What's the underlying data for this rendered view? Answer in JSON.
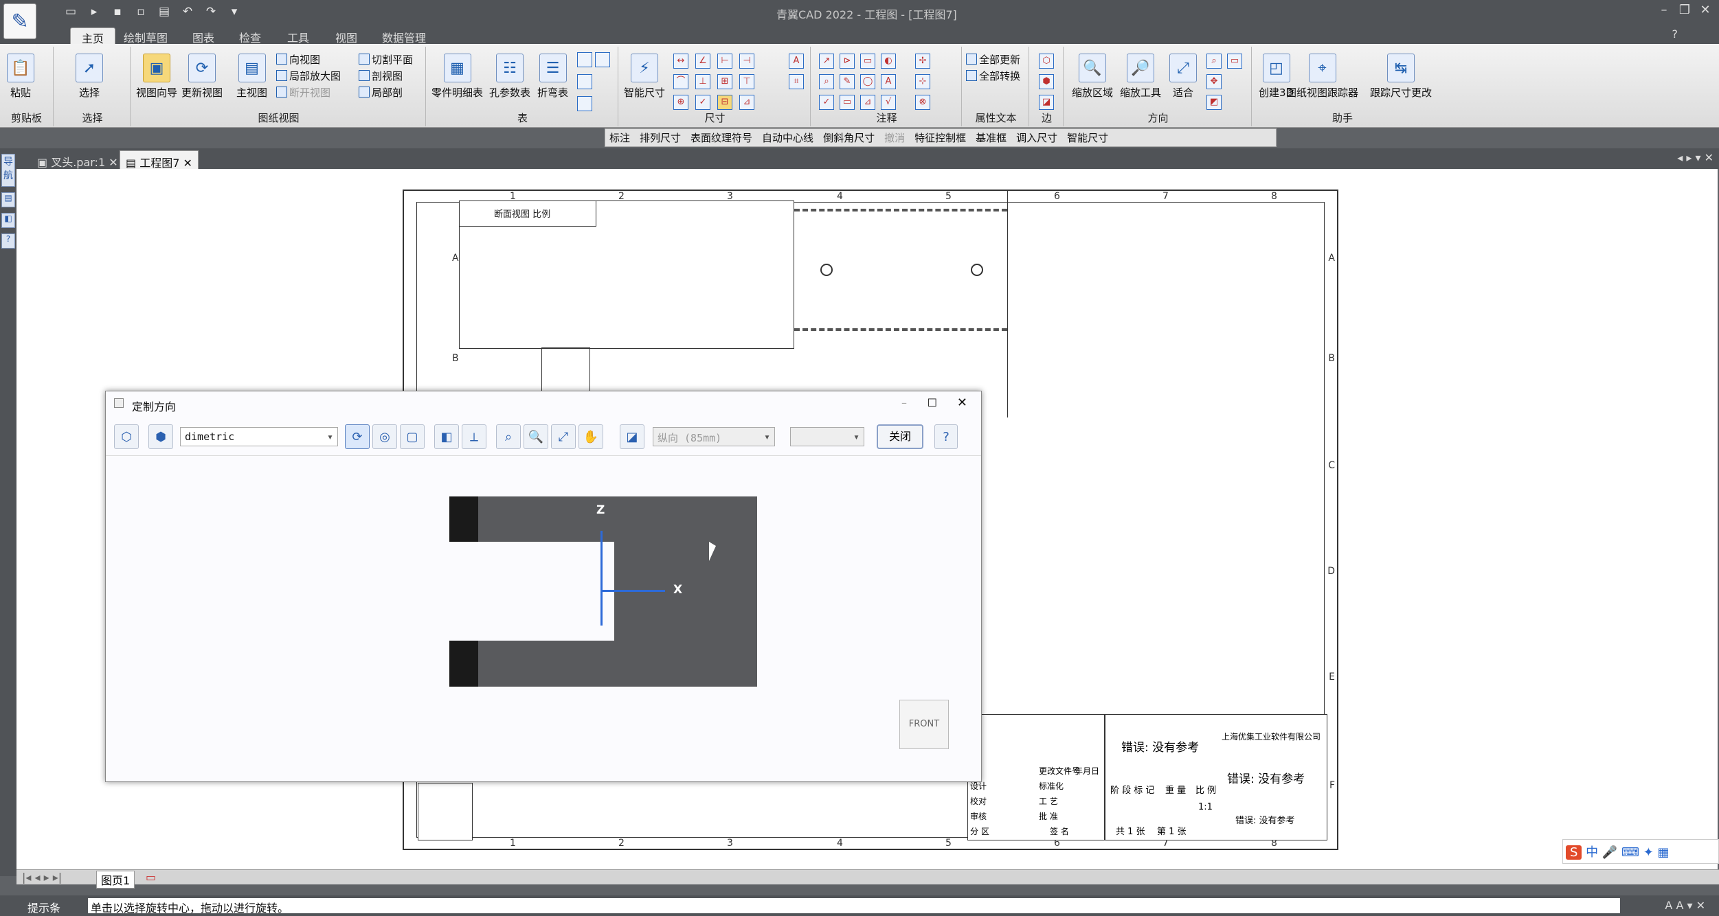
{
  "app": {
    "title": "青翼CAD 2022 - 工程图 - [工程图7]"
  },
  "ribbon_tabs": [
    "主页",
    "绘制草图",
    "图表",
    "检查",
    "工具",
    "视图",
    "数据管理"
  ],
  "groups": {
    "clipboard": {
      "label": "剪贴板",
      "paste": "粘贴"
    },
    "select": {
      "label": "选择",
      "select": "选择"
    },
    "drawing_views": {
      "label": "图纸视图",
      "view_wizard": "视图向导",
      "update_view": "更新视图",
      "main_view": "主视图",
      "direction_view": "向视图",
      "detail_view": "局部放大图",
      "break_view": "断开视图",
      "cut_plane": "切割平面",
      "section_view": "剖视图",
      "partial_section": "局部剖"
    },
    "table": {
      "label": "表",
      "parts_list": "零件明细表",
      "hole_table": "孔参数表",
      "bend_table": "折弯表"
    },
    "dimension": {
      "label": "尺寸",
      "smart_dimension": "智能尺寸"
    },
    "annotation": {
      "label": "注释"
    },
    "property_text": {
      "label": "属性文本",
      "update_all": "全部更新",
      "convert_all": "全部转换"
    },
    "edge": {
      "label": "边"
    },
    "orientation": {
      "label": "方向",
      "zoom_area": "缩放区域",
      "zoom_tool": "缩放工具",
      "fit": "适合"
    },
    "assistant": {
      "label": "助手",
      "create_3d": "创建3D",
      "view_tracker": "图纸视图跟踪器",
      "track_dim": "跟踪尺寸更改"
    }
  },
  "command_bar": [
    "标注",
    "排列尺寸",
    "表面纹理符号",
    "自动中心线",
    "倒斜角尺寸",
    "撤消",
    "特征控制框",
    "基准框",
    "调入尺寸",
    "智能尺寸"
  ],
  "doc_tabs": [
    "叉头.par:1",
    "工程图7"
  ],
  "left_panel_label": "导航",
  "sheet": {
    "cols": [
      "1",
      "2",
      "3",
      "4",
      "5",
      "6",
      "7",
      "8"
    ],
    "rows": [
      "A",
      "B",
      "C",
      "D",
      "E",
      "F"
    ],
    "view_label": "断面视图 比例",
    "title_block": {
      "error1": "错误: 没有参考",
      "error2": "错误: 没有参考",
      "error3": "错误: 没有参考",
      "company": "上海优集工业软件有限公司",
      "stage": "阶 段 标 记",
      "weight": "重 量",
      "scale_label": "比 例",
      "scale": "1:1",
      "sheets": "共 1 张",
      "sheet_no": "第 1 张",
      "design": "设计",
      "check": "校对",
      "review": "审核",
      "process": "工 艺",
      "approve": "批 准",
      "standard": "标准化",
      "region": "分 区",
      "change_doc": "更改文件号",
      "sign": "签 名",
      "date": "年月日"
    }
  },
  "page_tab": "图页1",
  "status": {
    "label": "提示条",
    "prompt": "单击以选择旋转中心，拖动以进行旋转。"
  },
  "dialog": {
    "title": "定制方向",
    "view_combo": "dimetric",
    "direction_combo": "纵向 (85mm)",
    "close_button": "关闭",
    "axis_z": "Z",
    "axis_x": "X",
    "front_label": "FRONT"
  },
  "tray": {
    "ime": "中"
  }
}
